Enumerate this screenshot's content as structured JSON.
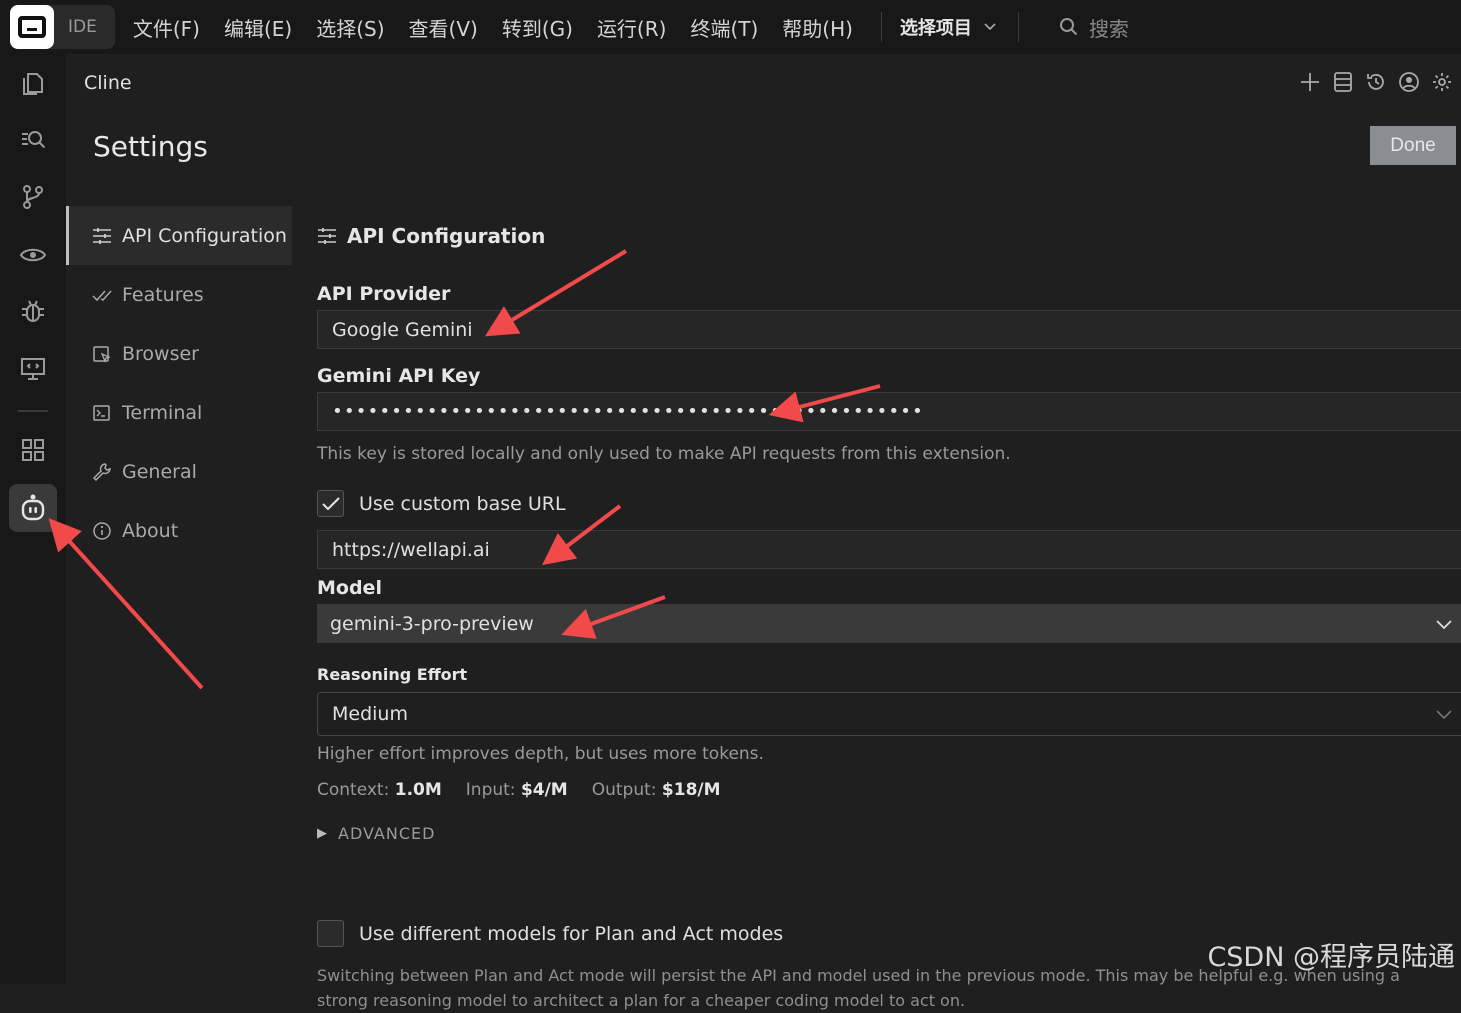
{
  "menubar": {
    "ide_label": "IDE",
    "items": [
      "文件(F)",
      "编辑(E)",
      "选择(S)",
      "查看(V)",
      "转到(G)",
      "运行(R)",
      "终端(T)",
      "帮助(H)"
    ],
    "project": "选择项目",
    "search_label": "搜索"
  },
  "activitybar": {
    "icons": [
      "files-icon",
      "search-icon",
      "source-control-icon",
      "eye-icon",
      "debug-icon",
      "remote-icon",
      "extensions-icon",
      "cline-bot-icon"
    ]
  },
  "panel": {
    "title": "Cline",
    "settings_heading": "Settings",
    "done_label": "Done"
  },
  "nav": {
    "items": [
      {
        "label": "API Configuration",
        "icon": "sliders-icon"
      },
      {
        "label": "Features",
        "icon": "check-all-icon"
      },
      {
        "label": "Browser",
        "icon": "browser-icon"
      },
      {
        "label": "Terminal",
        "icon": "terminal-icon"
      },
      {
        "label": "General",
        "icon": "wrench-icon"
      },
      {
        "label": "About",
        "icon": "info-icon"
      }
    ]
  },
  "api": {
    "heading": "API Configuration",
    "provider_label": "API Provider",
    "provider_value": "Google Gemini",
    "key_label": "Gemini API Key",
    "key_value": "••••••••••••••••••••••••••••••••••••••••••••••••••",
    "key_hint": "This key is stored locally and only used to make API requests from this extension.",
    "custom_url_label": "Use custom base URL",
    "custom_url_checked": true,
    "base_url": "https://wellapi.ai",
    "model_label": "Model",
    "model_value": "gemini-3-pro-preview",
    "reasoning_label": "Reasoning Effort",
    "reasoning_value": "Medium",
    "reasoning_hint": "Higher effort improves depth, but uses more tokens.",
    "context_label": "Context:",
    "context_value": "1.0M",
    "input_label": "Input:",
    "input_value": "$4/M",
    "output_label": "Output:",
    "output_value": "$18/M",
    "advanced_label": "ADVANCED",
    "plan_act_label": "Use different models for Plan and Act modes",
    "plan_act_checked": false,
    "plan_act_hint": "Switching between Plan and Act mode will persist the API and model used in the previous mode. This may be helpful e.g. when using a strong reasoning model to architect a plan for a cheaper coding model to act on."
  },
  "watermark": "CSDN @程序员陆通",
  "colors": {
    "background": "#1f1f1f",
    "sidebar": "#181818",
    "annotation_arrow": "#f24a4a",
    "done_button": "#8a8d91"
  }
}
